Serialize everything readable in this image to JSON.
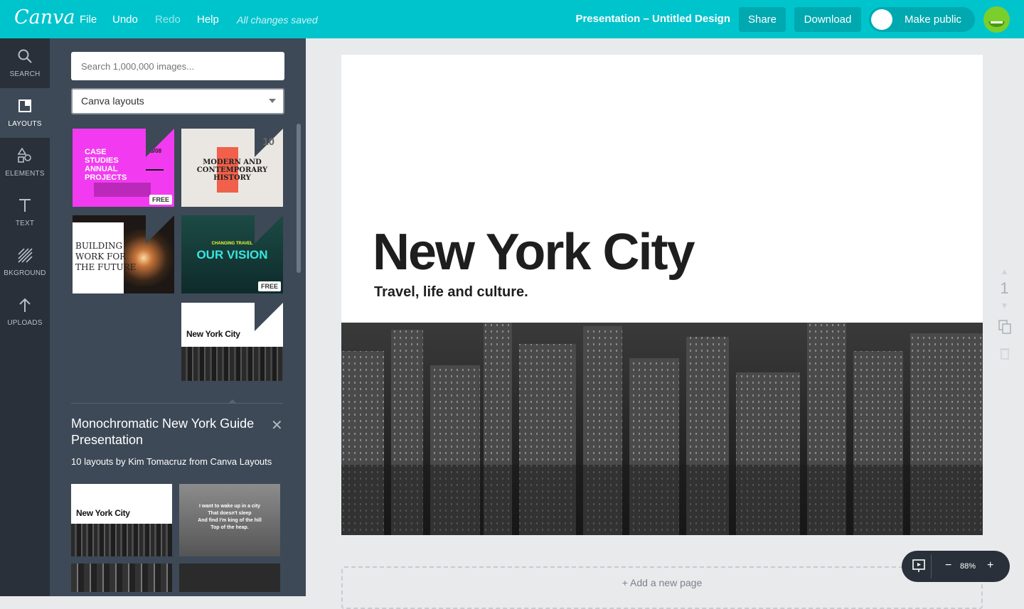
{
  "topbar": {
    "logo": "Canva",
    "menu": {
      "file": "File",
      "undo": "Undo",
      "redo": "Redo",
      "help": "Help"
    },
    "saved_status": "All changes saved",
    "doc_title": "Presentation – Untitled Design",
    "share": "Share",
    "download": "Download",
    "make_public": "Make public"
  },
  "rail": {
    "search": "SEARCH",
    "layouts": "LAYOUTS",
    "elements": "ELEMENTS",
    "text": "TEXT",
    "background": "BKGROUND",
    "uploads": "UPLOADS"
  },
  "panel": {
    "search_placeholder": "Search 1,000,000 images...",
    "select_value": "Canva layouts",
    "thumbs": {
      "case_studies": {
        "line1": "CASE",
        "line2": "STUDIES",
        "line3": "ANNUAL",
        "line4": "PROJECTS",
        "num": "08/08",
        "free": "FREE"
      },
      "history": {
        "num": "10",
        "line1": "MODERN AND",
        "line2": "CONTEMPORARY",
        "line3": "HISTORY"
      },
      "building": {
        "line1": "BUILDING",
        "line2": "WORK FOR",
        "line3": "THE FUTURE"
      },
      "vision": {
        "kicker": "CHANGING TRAVEL",
        "title": "OUR VISION",
        "free": "FREE"
      },
      "nyc_thumb": {
        "title": "New York City"
      }
    },
    "collection_title": "Monochromatic New York Guide Presentation",
    "collection_by": "10 layouts by Kim Tomacruz from Canva Layouts",
    "preview": {
      "nyc": "New York City",
      "quote_l1": "I want to wake up in a city",
      "quote_l2": "That doesn't sleep",
      "quote_l3": "And find I'm king of the hill",
      "quote_l4": "Top of the heap."
    }
  },
  "canvas": {
    "title": "New York City",
    "subtitle": "Travel, life and culture.",
    "add_page": "+ Add a new page",
    "page_number": "1"
  },
  "zoom": {
    "minus": "−",
    "value": "88%",
    "plus": "+"
  }
}
